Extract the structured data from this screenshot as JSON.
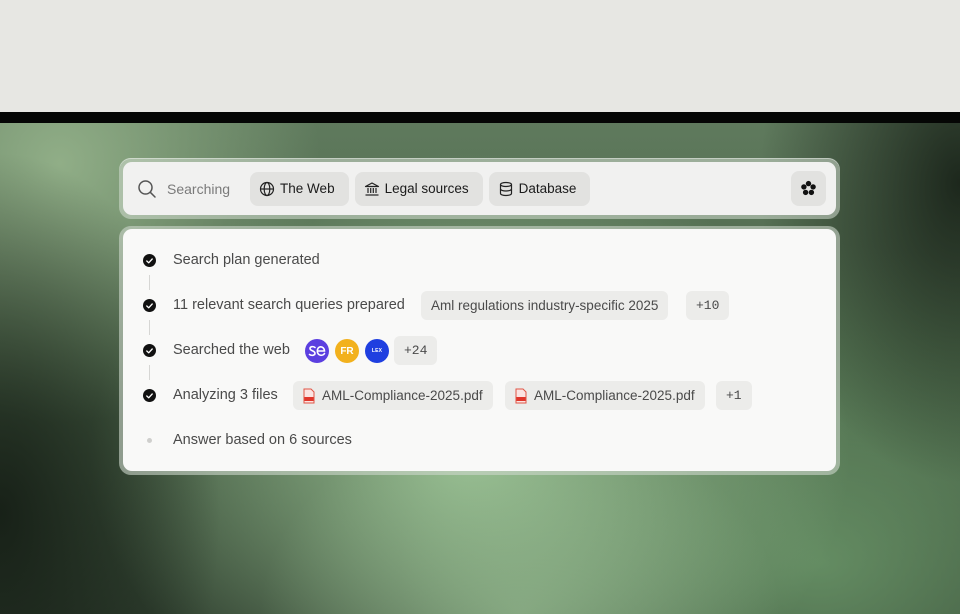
{
  "search_bar": {
    "label": "Searching",
    "chips": [
      {
        "label": "The Web",
        "icon": "globe-icon"
      },
      {
        "label": "Legal sources",
        "icon": "bank-icon"
      },
      {
        "label": "Database",
        "icon": "database-icon"
      }
    ],
    "action_icon": "flower-icon"
  },
  "steps": [
    {
      "text": "Search plan generated",
      "status": "done"
    },
    {
      "text": "11 relevant search queries prepared",
      "status": "done",
      "query": "Aml regulations industry-specific 2025",
      "more": "+10"
    },
    {
      "text": "Searched the web",
      "status": "done",
      "sources": [
        {
          "icon": "se-logo-icon",
          "text": "",
          "color": "#5b3fe0"
        },
        {
          "icon": "fr-logo-icon",
          "text": "FR",
          "color": "#f2b11d"
        },
        {
          "icon": "lex-logo-icon",
          "text": "LEX",
          "color": "#1f3fe0"
        }
      ],
      "more": "+24"
    },
    {
      "text": "Analyzing 3 files",
      "status": "done",
      "files": [
        "AML-Compliance-2025.pdf",
        "AML-Compliance-2025.pdf"
      ],
      "more": "+1"
    },
    {
      "text": "Answer based on 6 sources",
      "status": "pending"
    }
  ]
}
